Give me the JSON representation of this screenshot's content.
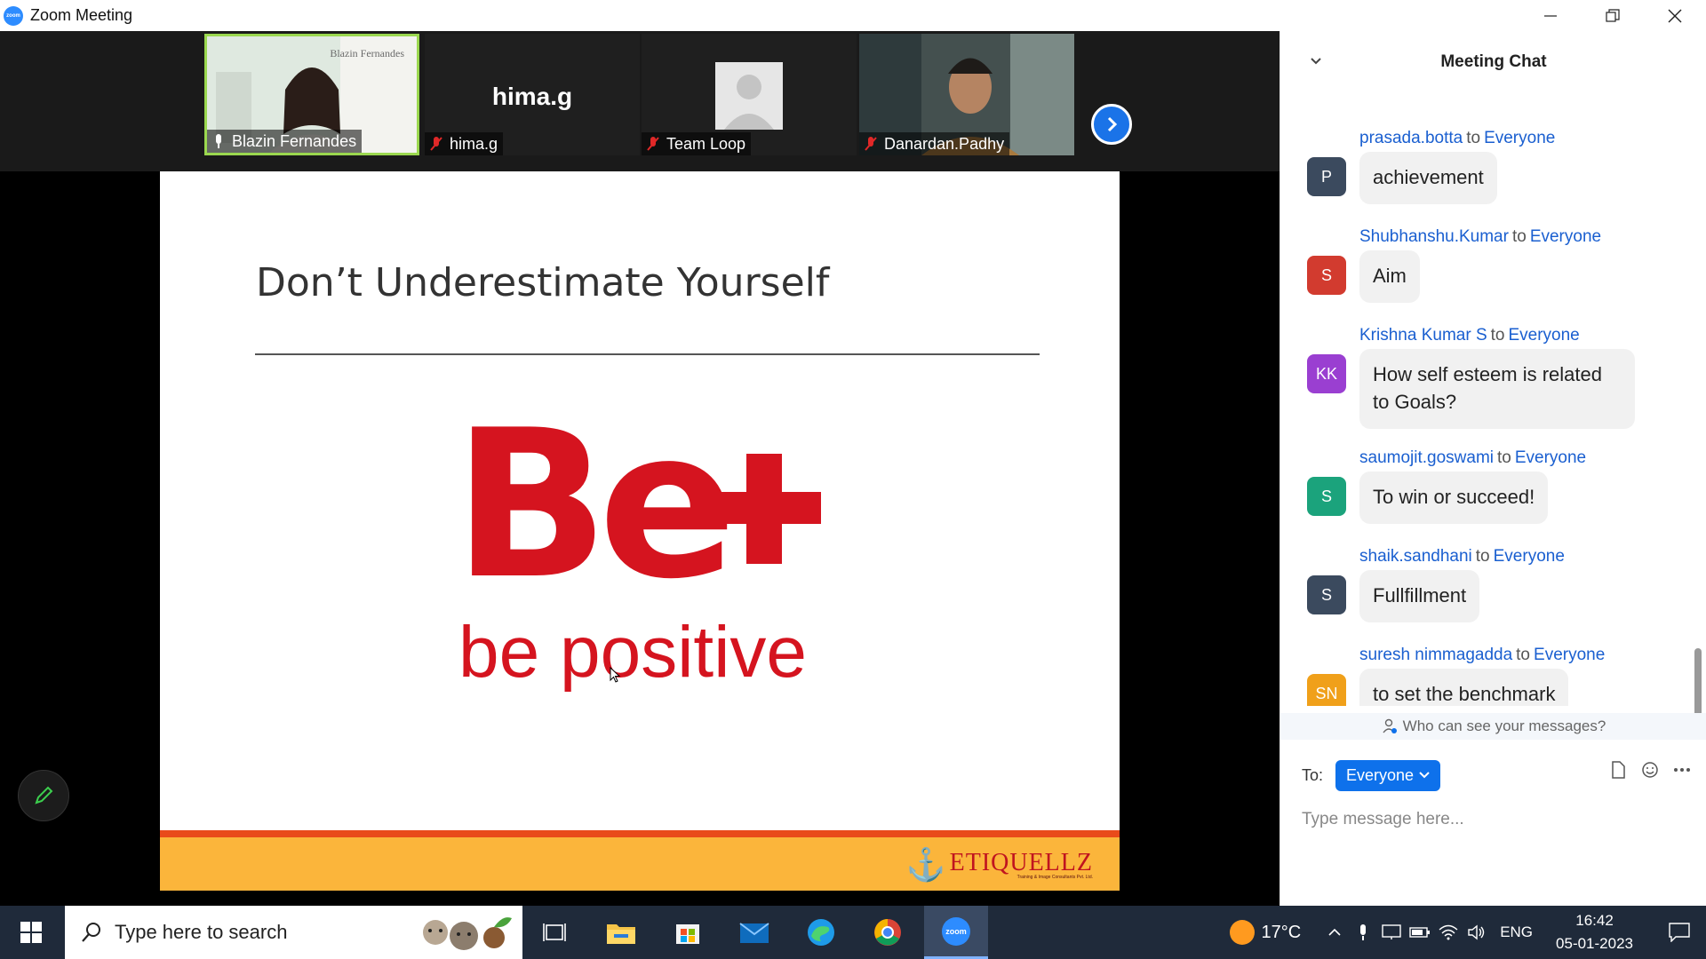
{
  "window": {
    "title": "Zoom Meeting",
    "logo_text": "zoom",
    "minimize": "–",
    "restore": "❐",
    "close": "✕"
  },
  "participants": [
    {
      "name": "Blazin Fernandes",
      "active": true,
      "video": true,
      "overlay_text": "Blazin Fernandes"
    },
    {
      "name": "hima.g",
      "active": false,
      "video": false,
      "big_name": "hima.g"
    },
    {
      "name": "Team Loop",
      "active": false,
      "video": false
    },
    {
      "name": "Danardan.Padhy",
      "active": false,
      "video": true
    }
  ],
  "slide": {
    "title": "Don’t Underestimate Yourself",
    "big_text": "Be",
    "tagline": "be positive",
    "brand": "ETIQUELLZ",
    "brand_tagline": "Training & Image Consultants Pvt. Ltd."
  },
  "chat": {
    "title": "Meeting Chat",
    "messages": [
      {
        "initials": "P",
        "color": "#3b4a5e",
        "sender": "prasada.botta",
        "to": "to",
        "recipient": "Everyone",
        "text": "achievement"
      },
      {
        "initials": "S",
        "color": "#d23b2f",
        "sender": "Shubhanshu.Kumar",
        "to": "to",
        "recipient": "Everyone",
        "text": "Aim"
      },
      {
        "initials": "KK",
        "color": "#9a3fd1",
        "sender": "Krishna Kumar S",
        "to": "to",
        "recipient": "Everyone",
        "text": "How self esteem is related to Goals?"
      },
      {
        "initials": "S",
        "color": "#1ba37c",
        "sender": "saumojit.goswami",
        "to": "to",
        "recipient": "Everyone",
        "text": "To win or succeed!"
      },
      {
        "initials": "S",
        "color": "#3b4a5e",
        "sender": "shaik.sandhani",
        "to": "to",
        "recipient": "Everyone",
        "text": "Fullfillment"
      },
      {
        "initials": "SN",
        "color": "#f0a01a",
        "sender": "suresh nimmagadda",
        "to": "to",
        "recipient": "Everyone",
        "text": "to set the benchmark"
      }
    ],
    "privacy_text": "Who can see your messages?",
    "to_label": "To:",
    "recipient_select": "Everyone",
    "input_placeholder": "Type message here..."
  },
  "taskbar": {
    "search_placeholder": "Type here to search",
    "weather": "17°C",
    "language": "ENG",
    "time": "16:42",
    "date": "05-01-2023",
    "zoom_label": "zoom"
  }
}
